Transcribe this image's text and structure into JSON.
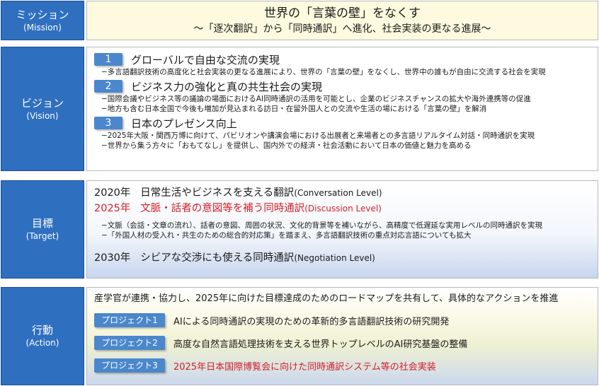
{
  "mission": {
    "label_jp": "ミッション",
    "label_en": "(Mission)",
    "title": "世界の「言葉の壁」をなくす",
    "subtitle": "〜「逐次翻訳」から「同時通訳」へ進化、社会実装の更なる進展〜"
  },
  "vision": {
    "label_jp": "ビジョン",
    "label_en": "(Vision)",
    "items": [
      {
        "num": "1",
        "title": "グローバルで自由な交流の実現",
        "lines": [
          "−多言語翻訳技術の高度化と社会実装の更なる進展により、世界の「言葉の壁」をなくし、世界中の誰もが自由に交流する社会を実現"
        ]
      },
      {
        "num": "2",
        "title": "ビジネス力の強化と真の共生社会の実現",
        "lines": [
          "−国際会議やビジネス等の議論の場面におけるAI同時通訳の活用を可能とし、企業のビジネスチャンスの拡大や海外連携等の促進",
          "−地方も含む日本全国で今後も増加が見込まれる訪日・在留外国人との交流や生活の場における「言葉の壁」を解消"
        ]
      },
      {
        "num": "3",
        "title": "日本のプレゼンス向上",
        "lines": [
          "−2025年大阪・関西万博に向けて、パビリオンや講演会場における出展者と来場者との多言語リアルタイム対話・同時通訳を実現",
          "−世界から集う方々に「おもてなし」を提供し、国内外での経済・社会活動において日本の価値と魅力を高める"
        ]
      }
    ]
  },
  "target": {
    "label_jp": "目標",
    "label_en": "(Target)",
    "levels": [
      {
        "year": "2020年",
        "text": "日常生活やビジネスを支える翻訳",
        "level": "(Conversation Level)"
      },
      {
        "year": "2025年",
        "text": "文脈・話者の意図等を補う同時通訳",
        "level": "(Discussion Level)"
      },
      {
        "year": "2030年",
        "text": "シビアな交渉にも使える同時通訳",
        "level": "(Negotiation Level)"
      }
    ],
    "lines": [
      "−文脈（会話・文章の流れ）、話者の意図、周囲の状況、文化的背景等を補いながら、高精度で低遅延な実用レベルの同時通訳を実現",
      "−「外国人材の受入れ・共生のための総合的対応策」を踏まえ、多言語翻訳技術の重点対応言語についても拡大"
    ],
    "highlight_color": "#d4202a"
  },
  "action": {
    "label_jp": "行動",
    "label_en": "(Action)",
    "intro": "産学官が連携・協力し、2025年に向けた目標達成のためのロードマップを共有して、具体的なアクションを推進",
    "projects": [
      {
        "badge": "プロジェクト1",
        "text": "AIによる同時通訳の実現のための革新的多言語翻訳技術の研究開発"
      },
      {
        "badge": "プロジェクト2",
        "text": "高度な自然言語処理技術を支える世界トップレベルのAI研究基盤の整備"
      },
      {
        "badge": "プロジェクト3",
        "text": "2025年日本国際博覧会に向けた同時通訳システム等の社会実装"
      }
    ]
  },
  "colors": {
    "label_bg": "#2f6fbf",
    "badge_bg": "#4a87cc",
    "mission_bg": "#fdfadf"
  }
}
